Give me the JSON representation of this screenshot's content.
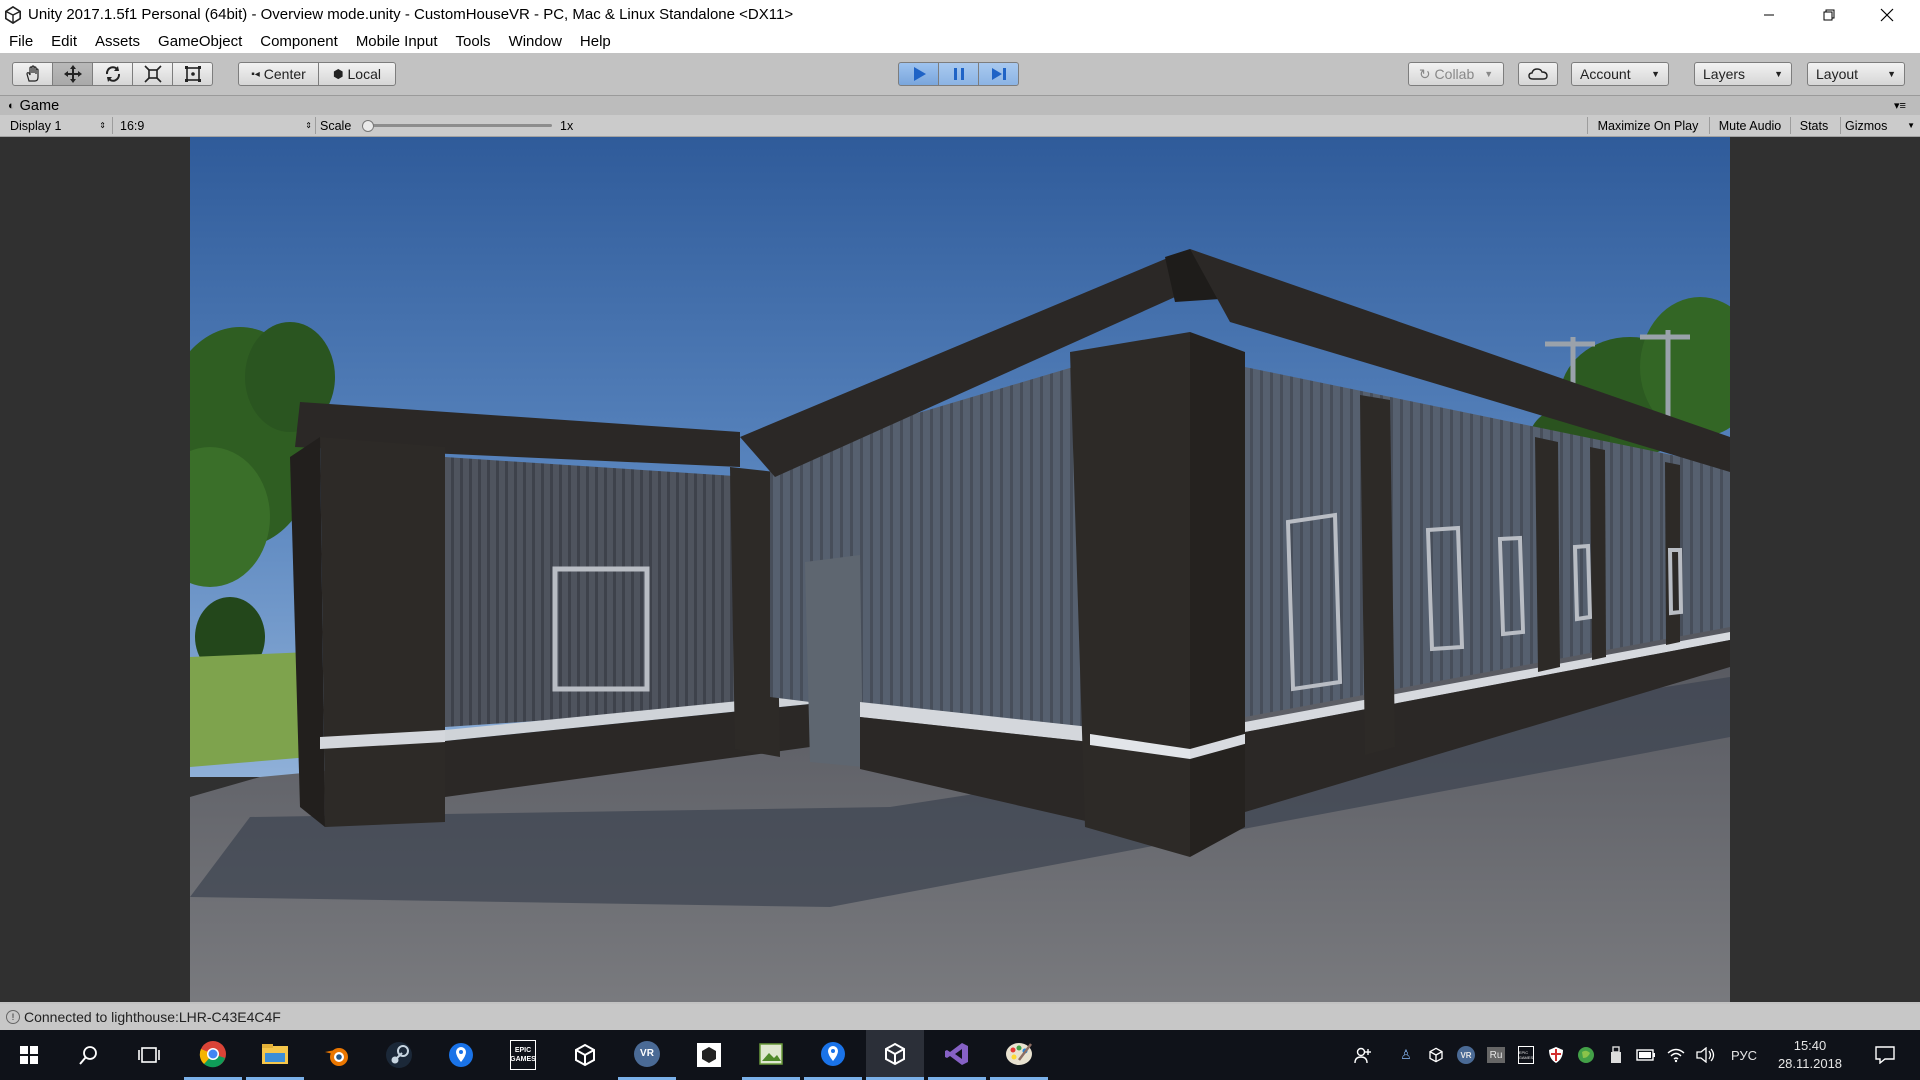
{
  "window": {
    "title": "Unity 2017.1.5f1 Personal (64bit) - Overview mode.unity - CustomHouseVR - PC, Mac & Linux Standalone <DX11>"
  },
  "menu": [
    "File",
    "Edit",
    "Assets",
    "GameObject",
    "Component",
    "Mobile Input",
    "Tools",
    "Window",
    "Help"
  ],
  "toolbar": {
    "pivot_label": "Center",
    "space_label": "Local",
    "collab_label": "Collab",
    "account_label": "Account",
    "layers_label": "Layers",
    "layout_label": "Layout"
  },
  "game_view": {
    "tab_label": "Game",
    "display": "Display 1",
    "aspect": "16:9",
    "scale_label": "Scale",
    "scale_value": "1x",
    "scale_fraction": 0.0,
    "maximize_label": "Maximize On Play",
    "mute_label": "Mute Audio",
    "stats_label": "Stats",
    "gizmos_label": "Gizmos"
  },
  "status": {
    "message": "Connected to lighthouse:LHR-C43E4C4F"
  },
  "taskbar": {
    "pinned": [
      "start-icon",
      "search-icon",
      "task-view-icon",
      "chrome-icon",
      "file-explorer-icon",
      "blender-icon",
      "steam-icon",
      "maps-icon",
      "epic-games-icon",
      "unity-icon",
      "vr-icon",
      "unity-hub-icon",
      "image-editor-icon",
      "maps-icon",
      "unity-icon",
      "visual-studio-icon",
      "paint-icon"
    ],
    "epic_label": "EPIC\nGAMES",
    "vr_label": "VR",
    "lang_label": "Ru",
    "input_lang": "РУС",
    "time": "15:40",
    "date": "28.11.2018"
  },
  "colors": {
    "play_active": "#8fb8ea",
    "taskbar_bg": "#0f1219",
    "editor_bg": "#c2c2c2"
  }
}
